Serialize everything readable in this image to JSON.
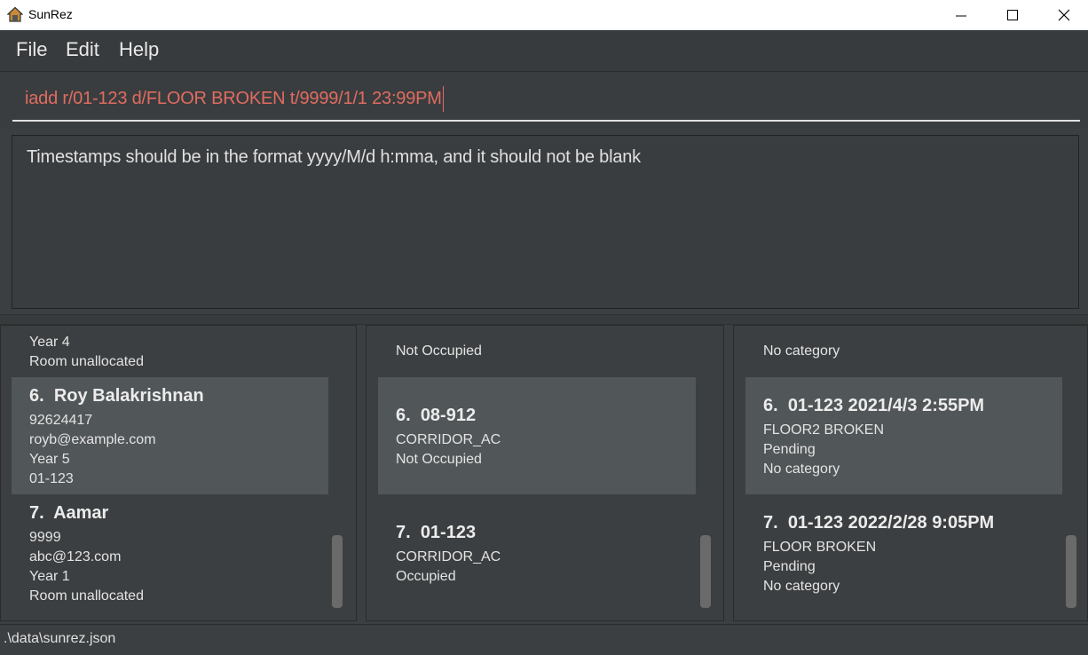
{
  "window": {
    "title": "SunRez"
  },
  "menu": {
    "file": "File",
    "edit": "Edit",
    "help": "Help"
  },
  "command": {
    "value": "iadd r/01-123 d/FLOOR BROKEN t/9999/1/1 23:99PM"
  },
  "result": {
    "message": "Timestamps should be in the format yyyy/M/d h:mma, and it should not be blank"
  },
  "residents": {
    "partial": {
      "year": "Year 4",
      "room": "Room unallocated"
    },
    "items": [
      {
        "index": "6.",
        "name": "Roy Balakrishnan",
        "phone": "92624417",
        "email": "royb@example.com",
        "year": "Year 5",
        "room": "01-123"
      },
      {
        "index": "7.",
        "name": "Aamar",
        "phone": "9999",
        "email": "abc@123.com",
        "year": "Year 1",
        "room": "Room unallocated"
      }
    ]
  },
  "rooms": {
    "partial": {
      "occupancy": "Not Occupied"
    },
    "items": [
      {
        "index": "6.",
        "number": "08-912",
        "type": "CORRIDOR_AC",
        "occupancy": "Not Occupied"
      },
      {
        "index": "7.",
        "number": "01-123",
        "type": "CORRIDOR_AC",
        "occupancy": "Occupied"
      }
    ]
  },
  "issues": {
    "partial": {
      "category": "No category"
    },
    "items": [
      {
        "index": "6.",
        "room": "01-123",
        "timestamp": "2021/4/3 2:55PM",
        "description": "FLOOR2 BROKEN",
        "status": "Pending",
        "category": "No category"
      },
      {
        "index": "7.",
        "room": "01-123",
        "timestamp": "2022/2/28 9:05PM",
        "description": "FLOOR BROKEN",
        "status": "Pending",
        "category": "No category"
      }
    ]
  },
  "statusbar": {
    "path": ".\\data\\sunrez.json"
  },
  "colors": {
    "selected_card": "#515658",
    "card": "#3c3f41",
    "error_text": "#e06c60"
  }
}
